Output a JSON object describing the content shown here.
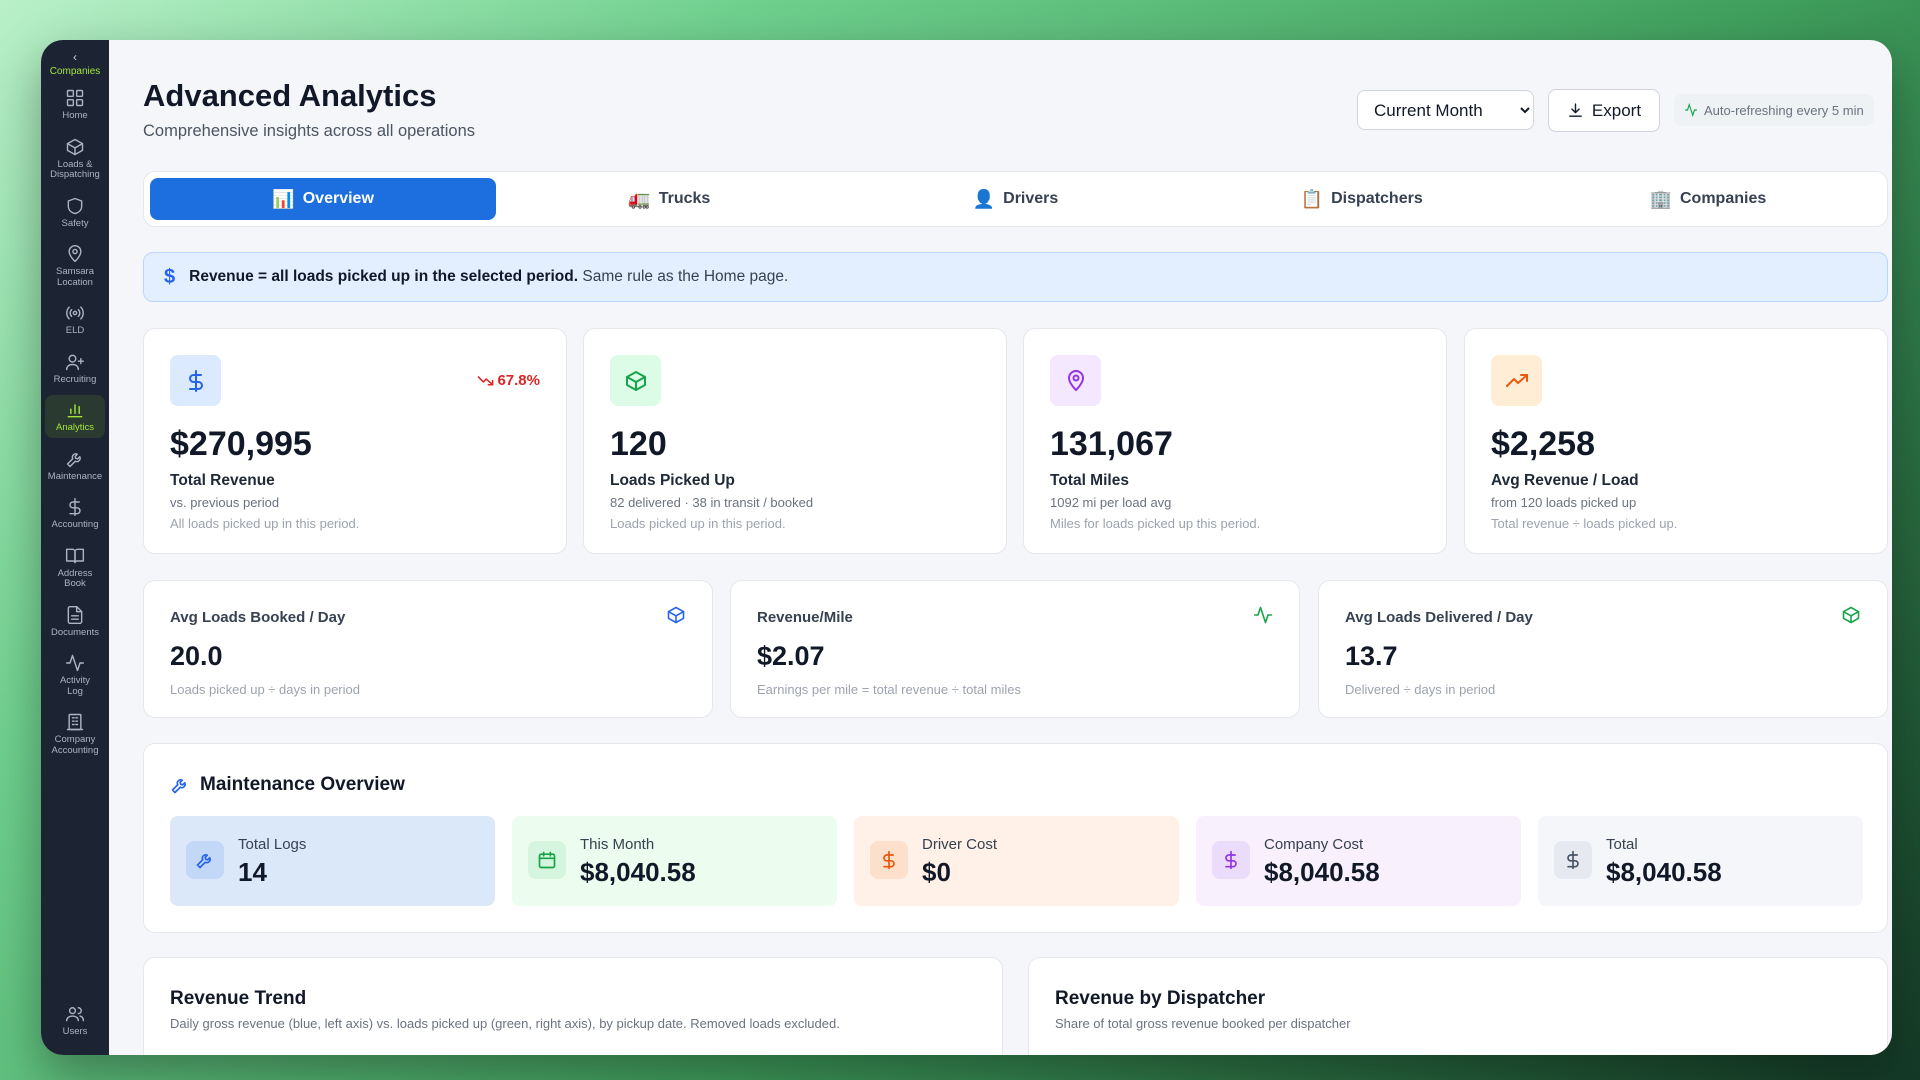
{
  "sidebar": {
    "back_label": "Companies",
    "items": [
      {
        "label": "Home"
      },
      {
        "label": "Loads &\nDispatching"
      },
      {
        "label": "Safety"
      },
      {
        "label": "Samsara\nLocation"
      },
      {
        "label": "ELD"
      },
      {
        "label": "Recruiting"
      },
      {
        "label": "Analytics"
      },
      {
        "label": "Maintenance"
      },
      {
        "label": "Accounting"
      },
      {
        "label": "Address\nBook"
      },
      {
        "label": "Documents"
      },
      {
        "label": "Activity\nLog"
      },
      {
        "label": "Company\nAccounting"
      }
    ],
    "bottom": {
      "label": "Users"
    }
  },
  "header": {
    "title": "Advanced Analytics",
    "subtitle": "Comprehensive insights across all operations",
    "period": "Current Month",
    "export_label": "Export",
    "autorefresh": "Auto-refreshing every 5 min"
  },
  "tabs": [
    {
      "label": "Overview",
      "emoji": "📊"
    },
    {
      "label": "Trucks",
      "emoji": "🚛"
    },
    {
      "label": "Drivers",
      "emoji": "👤"
    },
    {
      "label": "Dispatchers",
      "emoji": "📋"
    },
    {
      "label": "Companies",
      "emoji": "🏢"
    }
  ],
  "banner": {
    "bold": "Revenue = all loads picked up in the selected period.",
    "rest": "Same rule as the Home page."
  },
  "kpis": [
    {
      "value": "$270,995",
      "label": "Total Revenue",
      "sub1": "vs. previous period",
      "sub2": "All loads picked up in this period.",
      "trend": "67.8%"
    },
    {
      "value": "120",
      "label": "Loads Picked Up",
      "sub1": "82 delivered · 38 in transit / booked",
      "sub2": "Loads picked up in this period."
    },
    {
      "value": "131,067",
      "label": "Total Miles",
      "sub1": "1092 mi per load avg",
      "sub2": "Miles for loads picked up this period."
    },
    {
      "value": "$2,258",
      "label": "Avg Revenue / Load",
      "sub1": "from 120 loads picked up",
      "sub2": "Total revenue ÷ loads picked up."
    }
  ],
  "metrics": [
    {
      "title": "Avg Loads Booked / Day",
      "value": "20.0",
      "desc": "Loads picked up ÷ days in period"
    },
    {
      "title": "Revenue/Mile",
      "value": "$2.07",
      "desc": "Earnings per mile = total revenue ÷ total miles"
    },
    {
      "title": "Avg Loads Delivered / Day",
      "value": "13.7",
      "desc": "Delivered ÷ days in period"
    }
  ],
  "maintenance": {
    "title": "Maintenance Overview",
    "tiles": [
      {
        "label": "Total Logs",
        "value": "14"
      },
      {
        "label": "This Month",
        "value": "$8,040.58"
      },
      {
        "label": "Driver Cost",
        "value": "$0"
      },
      {
        "label": "Company Cost",
        "value": "$8,040.58"
      },
      {
        "label": "Total",
        "value": "$8,040.58"
      }
    ]
  },
  "charts": [
    {
      "title": "Revenue Trend",
      "subtitle": "Daily gross revenue (blue, left axis) vs. loads picked up (green, right axis), by pickup date. Removed loads excluded."
    },
    {
      "title": "Revenue by Dispatcher",
      "subtitle": "Share of total gross revenue booked per dispatcher"
    }
  ],
  "colors": {
    "accent": "#1d6fe0",
    "sidebar_bg": "#1c2433",
    "sidebar_active": "#a3e635",
    "negative": "#dc2626"
  }
}
